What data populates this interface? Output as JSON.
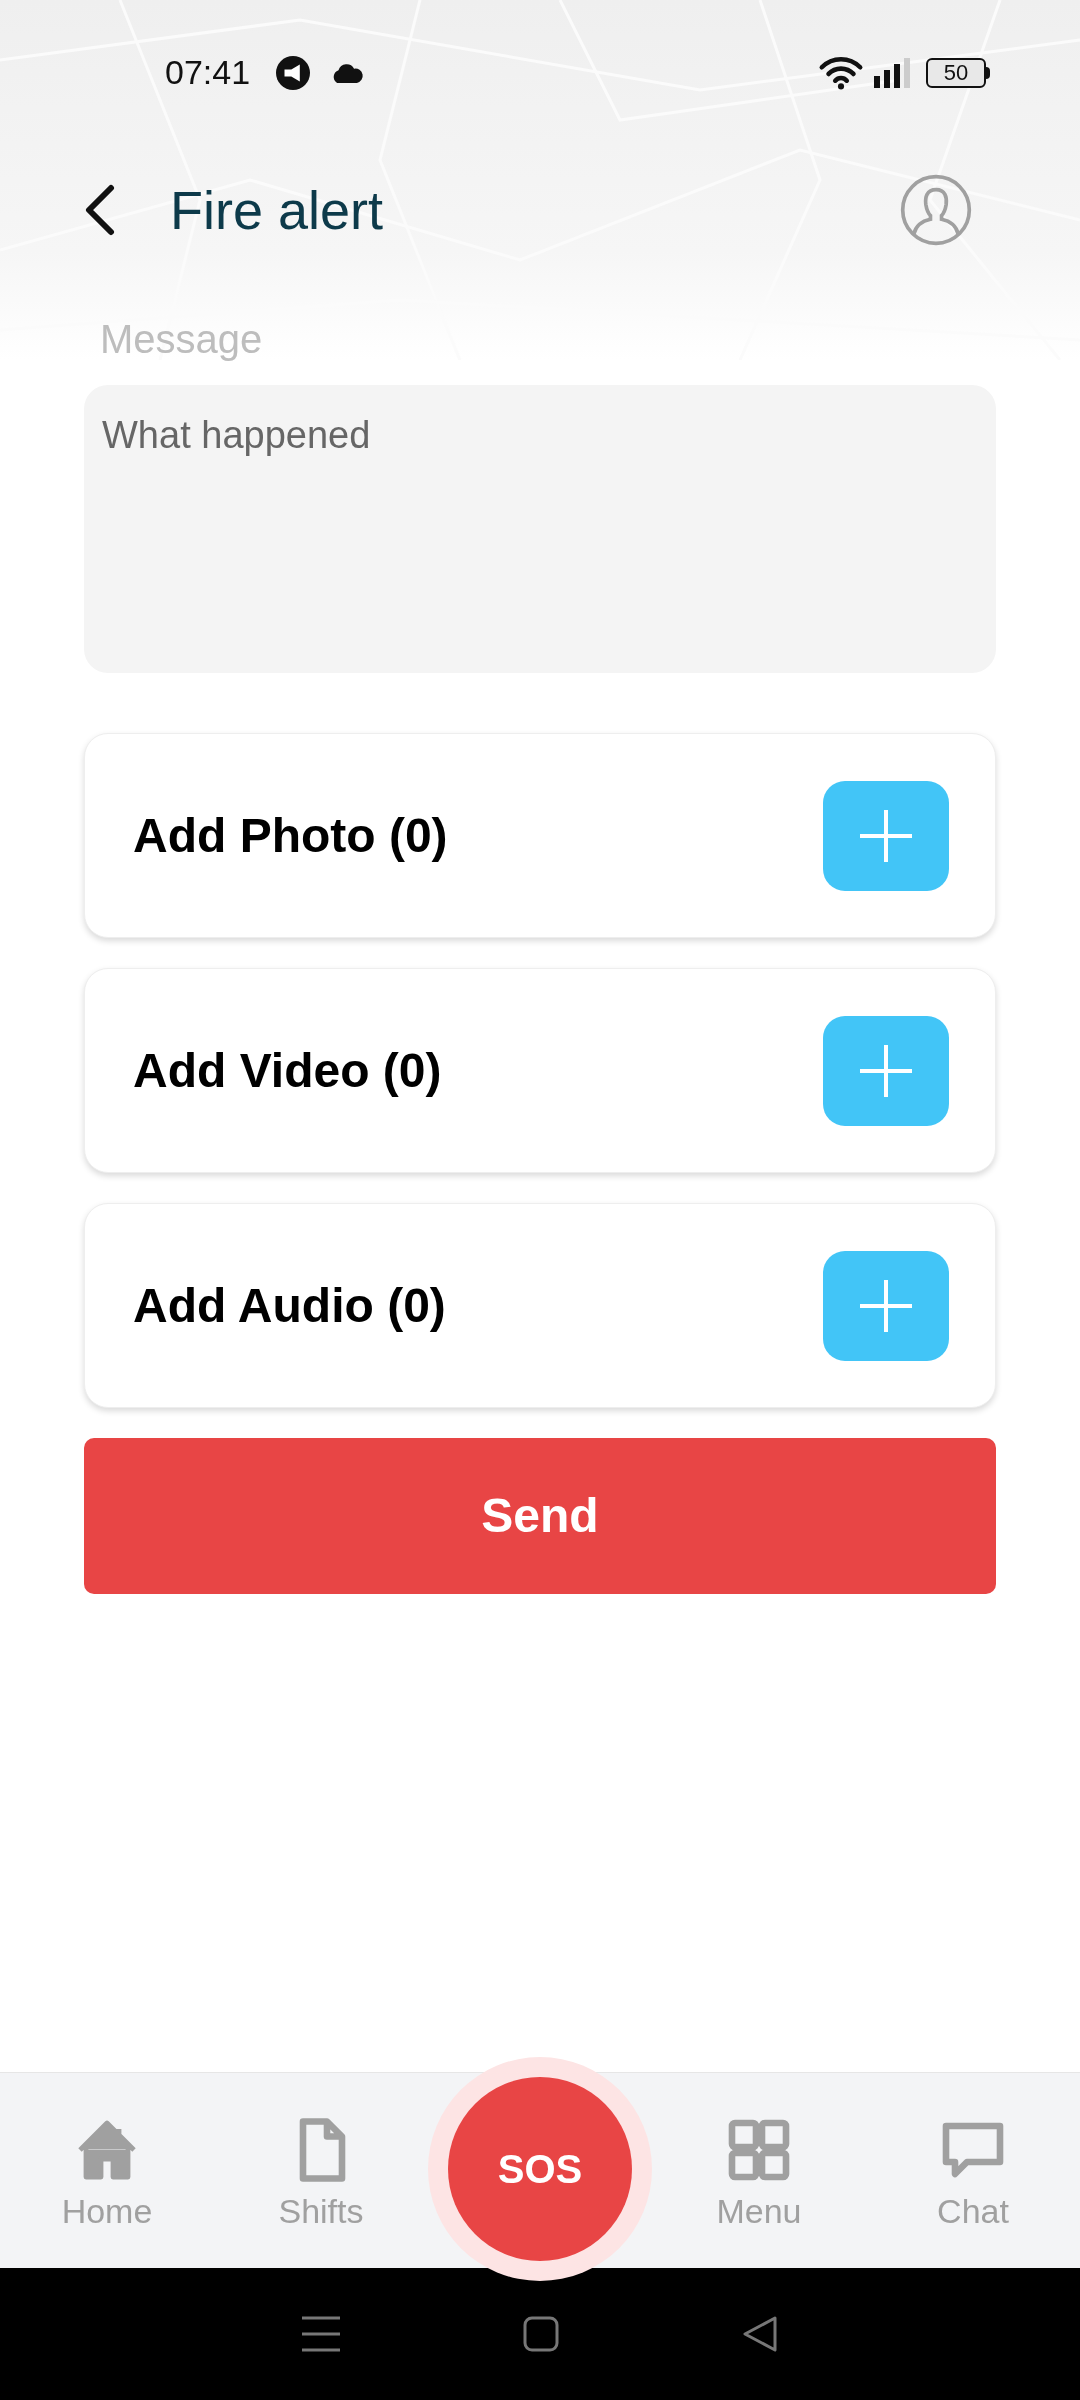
{
  "status_bar": {
    "time": "07:41",
    "battery": "50"
  },
  "header": {
    "title": "Fire alert"
  },
  "message": {
    "label": "Message",
    "placeholder": "What happened"
  },
  "attachments": [
    {
      "label": "Add Photo (0)"
    },
    {
      "label": "Add Video (0)"
    },
    {
      "label": "Add Audio (0)"
    }
  ],
  "send_button": "Send",
  "bottom_nav": [
    {
      "kind": "home",
      "label": "Home",
      "selected": false
    },
    {
      "kind": "file",
      "label": "Shifts",
      "selected": false
    },
    {
      "kind": "sos",
      "label": "SOS",
      "selected": false
    },
    {
      "kind": "grid",
      "label": "Menu",
      "selected": false
    },
    {
      "kind": "chat",
      "label": "Chat",
      "selected": false
    }
  ]
}
